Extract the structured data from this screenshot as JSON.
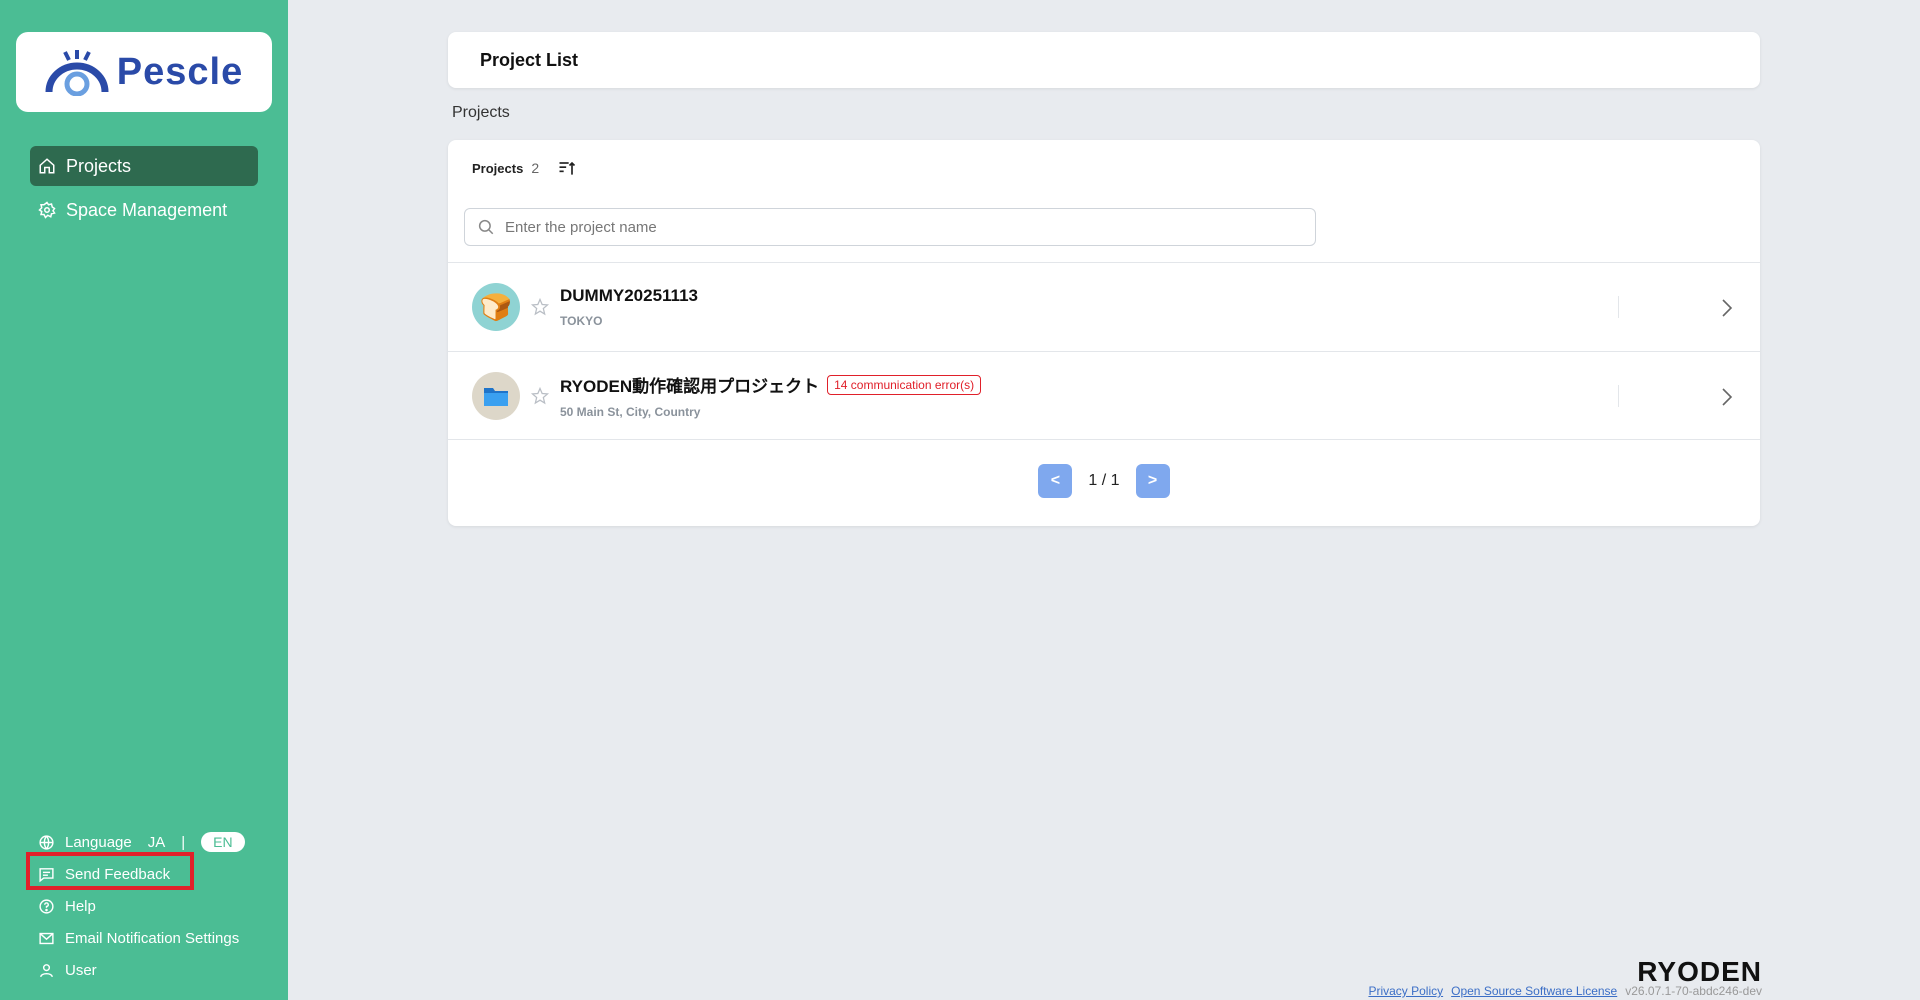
{
  "brand": {
    "logo_text": "Pescle",
    "footer_brand": "RYODEN"
  },
  "sidebar": {
    "nav": [
      {
        "label": "Projects",
        "icon": "home-icon",
        "active": true
      },
      {
        "label": "Space Management",
        "icon": "gear-icon",
        "active": false
      }
    ],
    "bottom": {
      "language_label": "Language",
      "lang_ja": "JA",
      "lang_sep": "|",
      "lang_en": "EN",
      "send_feedback": "Send Feedback",
      "help": "Help",
      "email_settings": "Email Notification Settings",
      "user": "User"
    }
  },
  "header": {
    "title": "Project List"
  },
  "section": {
    "label": "Projects"
  },
  "list": {
    "head_label": "Projects",
    "count": "2",
    "search_placeholder": "Enter the project name",
    "rows": [
      {
        "name": "DUMMY20251113",
        "subtitle": "TOKYO",
        "badge": ""
      },
      {
        "name": "RYODEN動作確認用プロジェクト",
        "subtitle": "50 Main St, City, Country",
        "badge": "14 communication error(s)"
      }
    ],
    "pager": {
      "prev": "<",
      "next": ">",
      "page": "1 / 1"
    }
  },
  "footer": {
    "privacy": "Privacy Policy",
    "oss": "Open Source Software License",
    "version": "v26.07.1-70-abdc246-dev"
  },
  "colors": {
    "sidebar": "#4bbd94",
    "active_nav": "#2e6a4f",
    "accent_button": "#7fa8ee",
    "error": "#e0202a"
  }
}
